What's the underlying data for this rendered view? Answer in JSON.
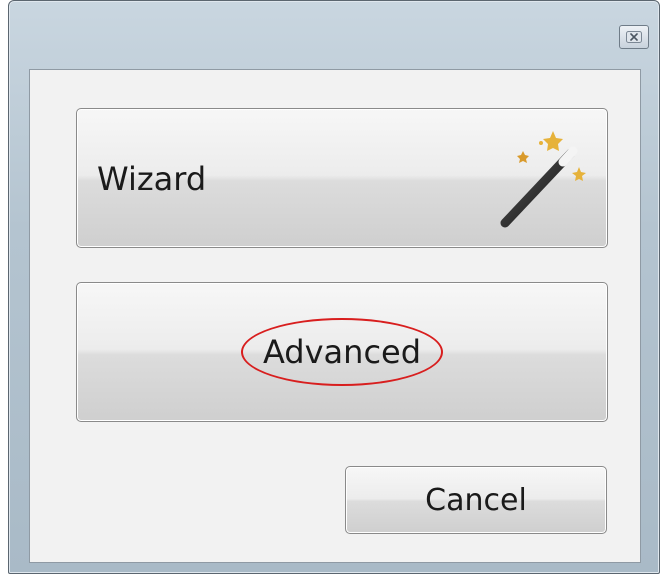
{
  "dialog": {
    "close_icon": "close-icon",
    "wizard_button": {
      "label": "Wizard",
      "icon": "magic-wand-icon"
    },
    "advanced_button": {
      "label": "Advanced",
      "highlight_color": "#d81e1e"
    },
    "cancel_button": {
      "label": "Cancel"
    }
  }
}
